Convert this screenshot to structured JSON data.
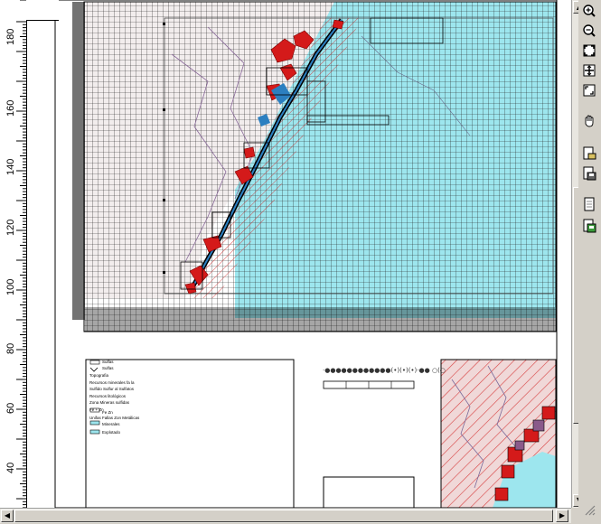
{
  "ruler": {
    "labels": [
      "180",
      "160",
      "140",
      "120",
      "100",
      "80",
      "60",
      "40"
    ]
  },
  "legend": {
    "items": [
      "Sulfas",
      "Sulfas",
      "Topografia",
      "Recursos minerales fa la",
      "Sulfido Sulfur al Sulfatos",
      "Recursos litológicos",
      "Zona Mineras sulfidas",
      "Fe + Zn",
      "Fe Zn",
      "Unifas Fallas Zon Metálicas",
      "Minerales",
      "Explotado"
    ]
  },
  "center_title": {
    "text": "·●●●●●●●●●●●●(•)(•)(•)·●●   ○(○"
  },
  "scrollbar": {
    "left_arrow": "◀",
    "right_arrow": "▶",
    "up_arrow": "▲",
    "down_arrow": "▼"
  },
  "toolbar": {
    "icons": [
      "zoom-in-icon",
      "zoom-out-icon",
      "zoom-extent-icon",
      "full-extent-icon",
      "zoom-selection-icon",
      "pan-hand-icon",
      "open-layer-icon",
      "save-layer-icon",
      "properties-icon",
      "export-icon"
    ]
  },
  "colors": {
    "map_cyan": "#9de6ee",
    "grid_line": "#202020",
    "feature_red": "#d41a1a",
    "feature_blue": "#2c7fc0",
    "hatch_red": "#d43030"
  }
}
